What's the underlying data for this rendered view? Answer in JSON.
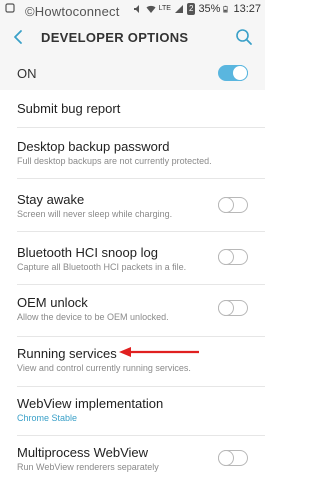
{
  "status_bar": {
    "time": "13:27",
    "battery": "35%",
    "network_label": "LTE",
    "sim_label": "2"
  },
  "watermark": "©Howtoconnect",
  "header": {
    "title": "DEVELOPER OPTIONS"
  },
  "master": {
    "label": "ON",
    "enabled": true
  },
  "items": [
    {
      "title": "Submit bug report",
      "subtitle": ""
    },
    {
      "title": "Desktop backup password",
      "subtitle": "Full desktop backups are not currently protected."
    },
    {
      "title": "Stay awake",
      "subtitle": "Screen will never sleep while charging.",
      "toggle": false
    },
    {
      "title": "Bluetooth HCI snoop log",
      "subtitle": "Capture all Bluetooth HCI packets in a file.",
      "toggle": false
    },
    {
      "title": "OEM unlock",
      "subtitle": "Allow the device to be OEM unlocked.",
      "toggle": false
    },
    {
      "title": "Running services",
      "subtitle": "View and control currently running services."
    },
    {
      "title": "WebView implementation",
      "subtitle": "Chrome Stable"
    },
    {
      "title": "Multiprocess WebView",
      "subtitle": "Run WebView renderers separately",
      "toggle": false
    }
  ],
  "colors": {
    "accent": "#5ab6df",
    "link": "#3aa0c8",
    "annotation_arrow": "#e02020",
    "header_bg": "#f6f6f6"
  },
  "icons": [
    "back-arrow-icon",
    "search-icon",
    "signal-icon",
    "wifi-icon",
    "battery-icon",
    "notification-icon"
  ]
}
